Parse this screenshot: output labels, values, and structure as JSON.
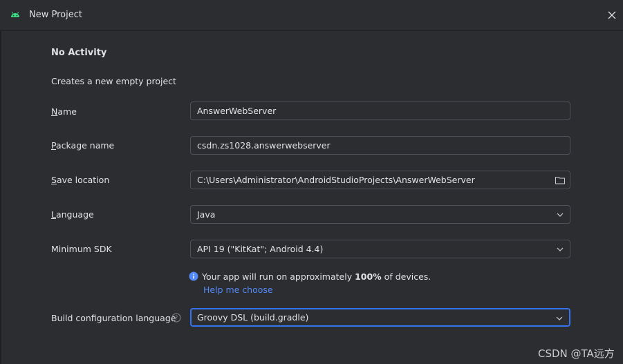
{
  "window": {
    "title": "New Project",
    "close_icon": "close-icon",
    "app_icon": "android-icon"
  },
  "template": {
    "heading": "No Activity",
    "description": "Creates a new empty project"
  },
  "form": {
    "name": {
      "label_ul": "N",
      "label_rest": "ame",
      "value": "AnswerWebServer"
    },
    "package": {
      "label_ul": "P",
      "label_rest": "ackage name",
      "value": "csdn.zs1028.answerwebserver"
    },
    "save_location": {
      "label_ul": "S",
      "label_rest": "ave location",
      "value": "C:\\Users\\Administrator\\AndroidStudioProjects\\AnswerWebServer"
    },
    "language": {
      "label_ul": "L",
      "label_rest": "anguage",
      "value": "Java"
    },
    "min_sdk": {
      "label": "Minimum SDK",
      "value": "API 19 (\"KitKat\"; Android 4.4)"
    },
    "build_config": {
      "label": "Build configuration language",
      "value": "Groovy DSL (build.gradle)"
    }
  },
  "sdk_info": {
    "prefix": "Your app will run on approximately ",
    "percent": "100%",
    "suffix": " of devices.",
    "help_link": "Help me choose"
  },
  "watermark": "CSDN @TA远方",
  "colors": {
    "background": "#2b2d30",
    "accent": "#3574f0",
    "link": "#548af7",
    "android_green": "#3ddc84"
  }
}
